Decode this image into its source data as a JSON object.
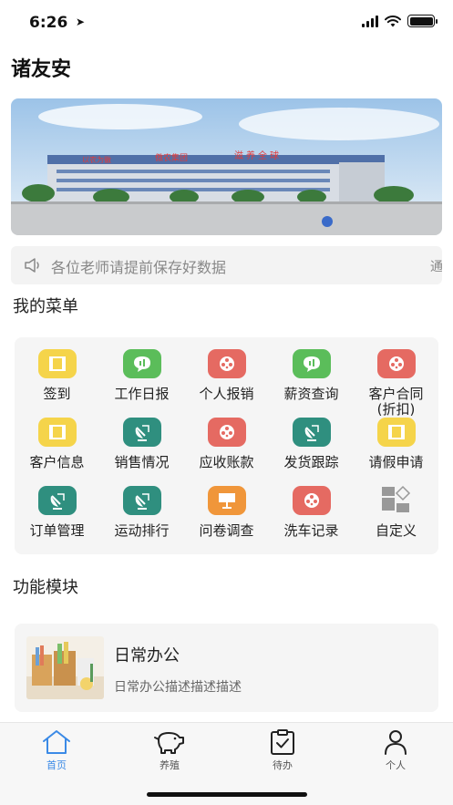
{
  "status_bar": {
    "time": "6:26"
  },
  "page": {
    "title": "诸友安"
  },
  "banner": {
    "sign_left": "以农为徽",
    "sign_company": "傲农集团",
    "sign_right": "滋养全球"
  },
  "notice": {
    "text": "各位老师请提前保存好数据",
    "text_next": "通知"
  },
  "menu": {
    "title": "我的菜单",
    "items": [
      {
        "label": "签到",
        "icon": "film-icon",
        "color": "#f5d44a"
      },
      {
        "label": "工作日报",
        "icon": "chat-icon",
        "color": "#5bbd5a"
      },
      {
        "label": "个人报销",
        "icon": "reel-icon",
        "color": "#e56a62"
      },
      {
        "label": "薪资查询",
        "icon": "chat-icon",
        "color": "#5bbd5a"
      },
      {
        "label": "客户合同\n(折扣)",
        "icon": "reel-icon",
        "color": "#e56a62"
      },
      {
        "label": "客户信息",
        "icon": "film-icon",
        "color": "#f5d44a"
      },
      {
        "label": "销售情况",
        "icon": "dish-icon",
        "color": "#2f8f7f"
      },
      {
        "label": "应收账款",
        "icon": "reel-icon",
        "color": "#e56a62"
      },
      {
        "label": "发货跟踪",
        "icon": "dish-icon",
        "color": "#2f8f7f"
      },
      {
        "label": "请假申请",
        "icon": "film-icon",
        "color": "#f5d44a"
      },
      {
        "label": "订单管理",
        "icon": "dish-icon",
        "color": "#2f8f7f"
      },
      {
        "label": "运动排行",
        "icon": "dish-icon",
        "color": "#2f8f7f"
      },
      {
        "label": "问卷调查",
        "icon": "presentation-icon",
        "color": "#f0963a"
      },
      {
        "label": "洗车记录",
        "icon": "reel-icon",
        "color": "#e56a62"
      },
      {
        "label": "自定义",
        "icon": "shapes-icon",
        "color": "#9a9a9a"
      }
    ]
  },
  "modules": {
    "title": "功能模块",
    "items": [
      {
        "title": "日常办公",
        "desc": "日常办公描述描述描述"
      }
    ]
  },
  "tabs": [
    {
      "label": "首页",
      "icon": "home-icon",
      "active": true
    },
    {
      "label": "养殖",
      "icon": "piggy-bank-icon",
      "active": false
    },
    {
      "label": "待办",
      "icon": "clipboard-check-icon",
      "active": false
    },
    {
      "label": "个人",
      "icon": "person-icon",
      "active": false
    }
  ],
  "colors": {
    "accent": "#3b8ae6"
  }
}
